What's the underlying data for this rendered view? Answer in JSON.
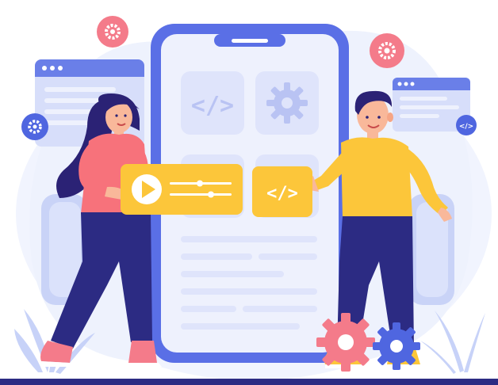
{
  "illustration": {
    "code_symbol": "</>",
    "colors": {
      "phone_frame": "#5a6fe6",
      "phone_screen": "#eef1fd",
      "tile": "#dfe4fb",
      "tile_icon": "#b9c3f3",
      "accent_yellow": "#fcc63a",
      "accent_yellow_dark": "#f4b326",
      "gear_pink": "#f47b8a",
      "gear_blue": "#4f66e0",
      "woman_shirt": "#f7727b",
      "man_shirt": "#fcc63a",
      "pants": "#2c2b83",
      "hair": "#2b2275",
      "skin": "#f9b89a",
      "ground_line": "#2c2b83",
      "background_blob": "#eef2fd"
    },
    "icons": [
      "gear-icon",
      "code-icon",
      "play-icon",
      "browser-window-icon",
      "plant-icon"
    ]
  }
}
